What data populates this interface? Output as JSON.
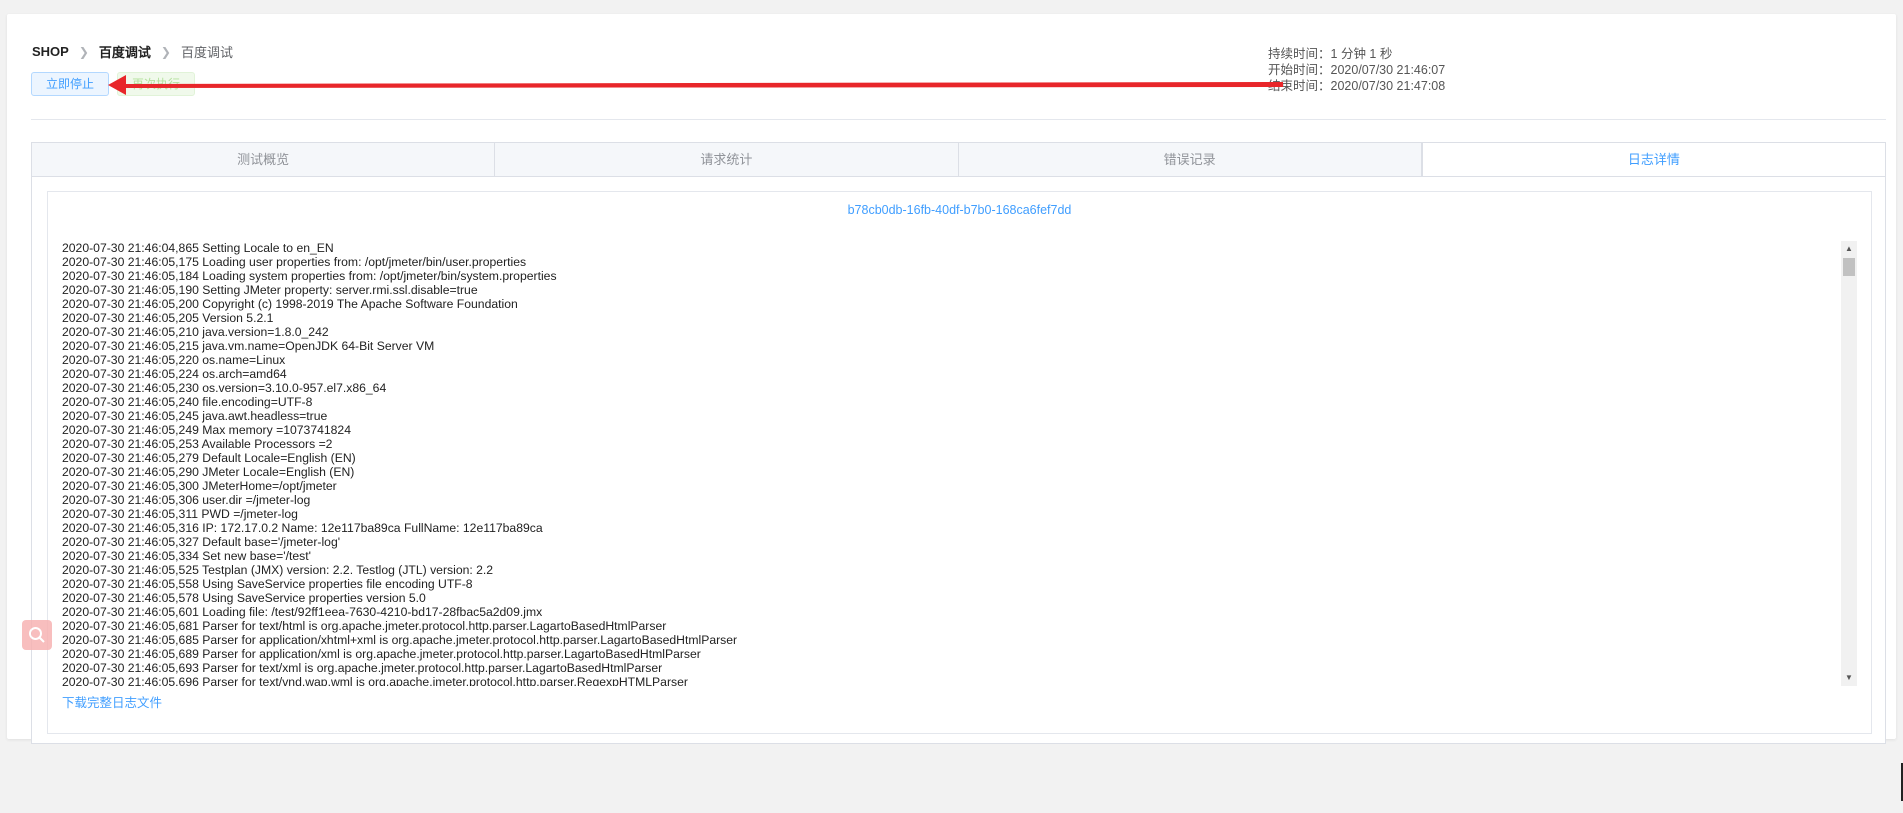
{
  "breadcrumb": {
    "root": "SHOP",
    "item1": "百度调试",
    "item2": "百度调试"
  },
  "actions": {
    "stop_label": "立即停止",
    "rerun_label": "再次执行"
  },
  "times": {
    "duration_label": "持续时间：",
    "duration_value": "1 分钟 1 秒",
    "start_label": "开始时间：",
    "start_value": "2020/07/30 21:46:07",
    "end_label": "结束时间：",
    "end_value": "2020/07/30 21:47:08"
  },
  "tabs": [
    {
      "label": "测试概览"
    },
    {
      "label": "请求统计"
    },
    {
      "label": "错误记录"
    },
    {
      "label": "日志详情"
    }
  ],
  "active_tab": "日志详情",
  "report_id": "b78cb0db-16fb-40df-b7b0-168ca6fef7dd",
  "log_lines": [
    "2020-07-30 21:46:04,865 Setting Locale to en_EN",
    "2020-07-30 21:46:05,175 Loading user properties from: /opt/jmeter/bin/user.properties",
    "2020-07-30 21:46:05,184 Loading system properties from: /opt/jmeter/bin/system.properties",
    "2020-07-30 21:46:05,190 Setting JMeter property: server.rmi.ssl.disable=true",
    "2020-07-30 21:46:05,200 Copyright (c) 1998-2019 The Apache Software Foundation",
    "2020-07-30 21:46:05,205 Version 5.2.1",
    "2020-07-30 21:46:05,210 java.version=1.8.0_242",
    "2020-07-30 21:46:05,215 java.vm.name=OpenJDK 64-Bit Server VM",
    "2020-07-30 21:46:05,220 os.name=Linux",
    "2020-07-30 21:46:05,224 os.arch=amd64",
    "2020-07-30 21:46:05,230 os.version=3.10.0-957.el7.x86_64",
    "2020-07-30 21:46:05,240 file.encoding=UTF-8",
    "2020-07-30 21:46:05,245 java.awt.headless=true",
    "2020-07-30 21:46:05,249 Max memory =1073741824",
    "2020-07-30 21:46:05,253 Available Processors =2",
    "2020-07-30 21:46:05,279 Default Locale=English (EN)",
    "2020-07-30 21:46:05,290 JMeter Locale=English (EN)",
    "2020-07-30 21:46:05,300 JMeterHome=/opt/jmeter",
    "2020-07-30 21:46:05,306 user.dir =/jmeter-log",
    "2020-07-30 21:46:05,311 PWD =/jmeter-log",
    "2020-07-30 21:46:05,316 IP: 172.17.0.2 Name: 12e117ba89ca FullName: 12e117ba89ca",
    "2020-07-30 21:46:05,327 Default base='/jmeter-log'",
    "2020-07-30 21:46:05,334 Set new base='/test'",
    "2020-07-30 21:46:05,525 Testplan (JMX) version: 2.2. Testlog (JTL) version: 2.2",
    "2020-07-30 21:46:05,558 Using SaveService properties file encoding UTF-8",
    "2020-07-30 21:46:05,578 Using SaveService properties version 5.0",
    "2020-07-30 21:46:05,601 Loading file: /test/92ff1eea-7630-4210-bd17-28fbac5a2d09.jmx",
    "2020-07-30 21:46:05,681 Parser for text/html is org.apache.jmeter.protocol.http.parser.LagartoBasedHtmlParser",
    "2020-07-30 21:46:05,685 Parser for application/xhtml+xml is org.apache.jmeter.protocol.http.parser.LagartoBasedHtmlParser",
    "2020-07-30 21:46:05,689 Parser for application/xml is org.apache.jmeter.protocol.http.parser.LagartoBasedHtmlParser",
    "2020-07-30 21:46:05,693 Parser for text/xml is org.apache.jmeter.protocol.http.parser.LagartoBasedHtmlParser",
    "2020-07-30 21:46:05,696 Parser for text/vnd.wap.wml is org.apache.jmeter.protocol.http.parser.RegexpHTMLParser"
  ],
  "download_label": "下载完整日志文件",
  "colors": {
    "primary": "#409eff",
    "annotation_arrow": "#e8262a",
    "page_bg": "#f2f2f2"
  },
  "icons": {
    "breadcrumb_separator": "chevron-right-icon",
    "floating_tool": "search-icon",
    "scroll_up": "triangle-up-icon",
    "scroll_down": "triangle-down-icon"
  }
}
